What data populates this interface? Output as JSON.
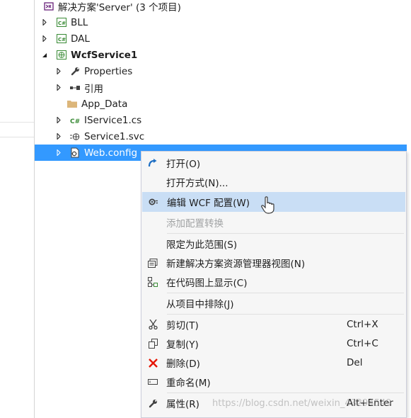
{
  "tree": {
    "solution": "解决方案'Server' (3 个项目)",
    "items": [
      {
        "label": "BLL",
        "icon": "csharp-project-icon"
      },
      {
        "label": "DAL",
        "icon": "csharp-project-icon"
      },
      {
        "label": "WcfService1",
        "icon": "web-project-icon"
      },
      {
        "label": "Properties",
        "icon": "wrench-icon"
      },
      {
        "label": "引用",
        "icon": "references-icon"
      },
      {
        "label": "App_Data",
        "icon": "folder-icon"
      },
      {
        "label": "IService1.cs",
        "icon": "csharp-file-icon"
      },
      {
        "label": "Service1.svc",
        "icon": "service-file-icon"
      },
      {
        "label": "Web.config",
        "icon": "config-file-icon"
      }
    ]
  },
  "menu": {
    "open": "打开(O)",
    "open_with": "打开方式(N)...",
    "edit_wcf": "编辑 WCF 配置(W)",
    "add_config_transform": "添加配置转换",
    "scope_to_this": "限定为此范围(S)",
    "new_solution_view": "新建解决方案资源管理器视图(N)",
    "show_on_code_map": "在代码图上显示(C)",
    "exclude_from_project": "从项目中排除(J)",
    "cut": "剪切(T)",
    "cut_key": "Ctrl+X",
    "copy": "复制(Y)",
    "copy_key": "Ctrl+C",
    "delete": "删除(D)",
    "delete_key": "Del",
    "rename": "重命名(M)",
    "properties": "属性(R)",
    "properties_key": "Alt+Enter"
  },
  "watermark": "https://blog.csdn.net/weixin_43294549",
  "colors": {
    "selection": "#3399ff",
    "menu_hover": "#c9def5",
    "delete_red": "#e51400"
  }
}
